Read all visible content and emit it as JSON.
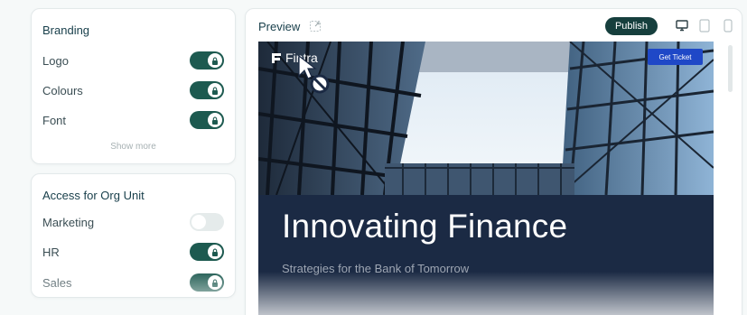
{
  "branding": {
    "title": "Branding",
    "items": [
      {
        "label": "Logo",
        "state": "on",
        "locked": true
      },
      {
        "label": "Colours",
        "state": "on",
        "locked": true
      },
      {
        "label": "Font",
        "state": "on",
        "locked": true
      }
    ],
    "show_more": "Show more"
  },
  "access": {
    "title": "Access for Org Unit",
    "items": [
      {
        "label": "Marketing",
        "state": "off",
        "locked": false
      },
      {
        "label": "HR",
        "state": "on",
        "locked": true
      },
      {
        "label": "Sales",
        "state": "on",
        "locked": true
      }
    ]
  },
  "preview": {
    "title": "Preview",
    "publish_label": "Publish",
    "devices": [
      "desktop-icon",
      "tablet-icon",
      "mobile-icon"
    ],
    "site": {
      "logo_text": "Fintra",
      "cta_label": "Get Ticket",
      "heading": "Innovating Finance",
      "subheading": "Strategies for the Bank of Tomorrow"
    }
  },
  "colors": {
    "accent": "#1d5a50",
    "publish": "#163f3d",
    "cta": "#1f48c7",
    "hero_bg": "#1b2a44"
  }
}
